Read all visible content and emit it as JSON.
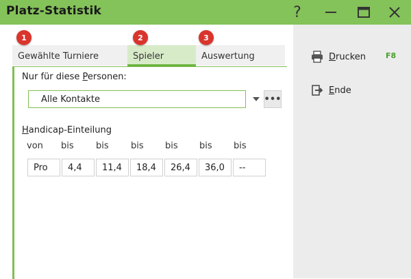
{
  "window": {
    "title": "Platz-Statistik",
    "help_glyph": "?",
    "accent_color": "#84c25a",
    "badge_color": "#d9352c"
  },
  "tabs": [
    {
      "badge": "1",
      "label": "Gewählte Turniere"
    },
    {
      "badge": "2",
      "label": "Spieler",
      "active": true
    },
    {
      "badge": "3",
      "label": "Auswertung"
    }
  ],
  "persons": {
    "label_pre": "Nur für diese ",
    "label_ul": "P",
    "label_post": "ersonen:",
    "selected": "Alle Kontakte",
    "more_button": "•••"
  },
  "handicap": {
    "label_ul": "H",
    "label_rest": "andicap-Einteilung",
    "headers": [
      "von",
      "bis",
      "bis",
      "bis",
      "bis",
      "bis",
      "bis"
    ],
    "values": [
      "Pro",
      "4,4",
      "11,4",
      "18,4",
      "26,4",
      "36,0",
      "--"
    ]
  },
  "sidebar": {
    "print": {
      "label_ul": "D",
      "label_rest": "rucken",
      "shortcut": "F8",
      "icon": "printer-icon"
    },
    "end": {
      "label_ul": "E",
      "label_rest": "nde",
      "icon": "exit-icon"
    }
  }
}
